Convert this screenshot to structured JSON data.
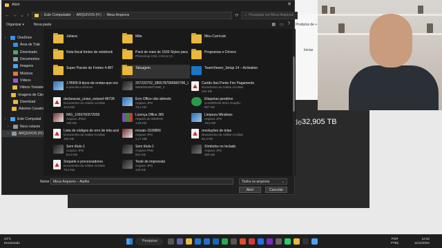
{
  "dialog": {
    "title": "Abrir",
    "close": "✕",
    "breadcrumb": [
      "Este Computador",
      "ARQUIVOS (H:)",
      "Meus Arquivos"
    ],
    "search_placeholder": "Pesquisar em Meus Arquivos",
    "toolbar": {
      "organize": "Organizar ▾",
      "new_folder": "Nova pasta"
    },
    "sidebar": [
      {
        "label": "OneDrive",
        "color": "#3a8ee6"
      },
      {
        "label": "Área de Trab",
        "color": "#3a8ee6"
      },
      {
        "label": "Downloads",
        "color": "#3fae5a"
      },
      {
        "label": "Documentos",
        "color": "#8d99a6"
      },
      {
        "label": "Imagens",
        "color": "#4aa3f0"
      },
      {
        "label": "Músicas",
        "color": "#e8743d"
      },
      {
        "label": "Vídeos",
        "color": "#9b59d0"
      },
      {
        "label": "Videos Youtube",
        "color": "#e8b93d"
      },
      {
        "label": "Imagens de Cân",
        "color": "#e8b93d"
      },
      {
        "label": "Download",
        "color": "#e8b93d"
      },
      {
        "label": "Adesivo Cavalei",
        "color": "#e8b93d"
      },
      {
        "label": "Este Computad",
        "color": "#4aa3f0"
      },
      {
        "label": "Novo volume",
        "color": "#8d99a6"
      },
      {
        "label": "ARQUIVOS (H:)",
        "color": "#8d99a6"
      }
    ],
    "files": [
      {
        "name": "Juliana",
        "sub": "",
        "sub2": "",
        "icon": "folder"
      },
      {
        "name": "Nota fiscal fontes de notebook",
        "sub": "",
        "sub2": "",
        "icon": "folder"
      },
      {
        "name": "Super Pacote de Fontes 4.487",
        "sub": "",
        "sub2": "",
        "icon": "folder"
      },
      {
        "name": "178905-8-tipos-de-ondas-que-voc",
        "sub": "e-precisa-conhecer",
        "sub2": "",
        "icon": "img"
      },
      {
        "name": "declaracao_uniao_estavel-48728",
        "sub": "Documento do Adobe Acrobat",
        "sub2": "42,8 KB",
        "icon": "pdf"
      },
      {
        "name": "IMG_1055760572059",
        "sub": "Arquivo JPEG",
        "sub2": "165 KB",
        "icon": "img2"
      },
      {
        "name": "Lista de códigos de erro de tela azul",
        "sub": "Documento do Adobe Acrobat",
        "sub2": "194 KB",
        "icon": "pdf"
      },
      {
        "name": "Sem título-1",
        "sub": "Arquivo JPG",
        "sub2": "54,3 KB",
        "icon": "img3"
      },
      {
        "name": "Soquete e processadores",
        "sub": "Documento do Adobe Acrobat",
        "sub2": "75,2 KB",
        "icon": "pdf"
      },
      {
        "name": "Mãe",
        "sub": "",
        "sub2": "",
        "icon": "folder"
      },
      {
        "name": "Pack de mais de 1500 Styles para",
        "sub": "Photoshop CS5, CS6 & CC",
        "sub2": "",
        "icon": "folder"
      },
      {
        "name": "Tatuagem",
        "sub": "",
        "sub2": "",
        "icon": "folder"
      },
      {
        "name": "207220702_385578758668378​6_2131",
        "sub": "08292524607​1980_n",
        "sub2": "",
        "icon": "img3"
      },
      {
        "name": "Erro Office não abrindo",
        "sub": "Arquivo JPG",
        "sub2": "79,1 KB",
        "icon": "img"
      },
      {
        "name": "Licença Office 365",
        "sub": "Arquivo do WinRAR",
        "sub2": "1,06 KB",
        "icon": "winrar"
      },
      {
        "name": "mosaic-1539856",
        "sub": "Arquivo JPG",
        "sub2": "1,17 MB",
        "icon": "img2"
      },
      {
        "name": "Sem título-1",
        "sub": "Arquivo PNG",
        "sub2": "921 KB",
        "icon": "img3"
      },
      {
        "name": "Teste de impressão",
        "sub": "Arquivo JPG",
        "sub2": "140 KB",
        "icon": "img3"
      },
      {
        "name": "Meu Currículo",
        "sub": "",
        "sub2": "",
        "icon": "folder"
      },
      {
        "name": "Programas e Drivers",
        "sub": "",
        "sub2": "",
        "icon": "folder"
      },
      {
        "name": "TeamViewer_Setup 14 – Activation",
        "sub": "",
        "sub2": "",
        "icon": "tv"
      },
      {
        "name": "Cartão Itaú Ponto Frio Pagamento",
        "sub": "Documento do Adobe Acrobat",
        "sub2": "234 KB",
        "icon": "pdf"
      },
      {
        "name": "Etiquetas pendrive",
        "sub": "CorelDRAW 2021 Graphic",
        "sub2": "907 KB",
        "icon": "coral"
      },
      {
        "name": "Limpeza Windows",
        "sub": "Arquivo JPG",
        "sub2": "16,6 KB",
        "icon": "img"
      },
      {
        "name": "resoluções de telas",
        "sub": "Documento do Adobe Acrobat",
        "sub2": "81,3 KB",
        "icon": "pdf"
      },
      {
        "name": "Símbolos no teclado",
        "sub": "Arquivo JPG",
        "sub2": "209 KB",
        "icon": "img3"
      }
    ],
    "footer": {
      "name_label": "Nome:",
      "name_value": "Meus Arquivos – Atalho",
      "filetype": "Todos os arquivos",
      "open": "Abrir",
      "cancel": "Cancelar"
    }
  },
  "background": {
    "tab_text": "Produtos de +",
    "tab_text2": "Iniciar",
    "size_label": "de",
    "size_value": "32,905 TB"
  },
  "taskbar": {
    "temp": "23°C",
    "weather": "Ensolarado",
    "search": "Pesquisar",
    "lang": "POR",
    "lang2": "PTB2",
    "time": "12:34",
    "date": "11/11/2022"
  }
}
